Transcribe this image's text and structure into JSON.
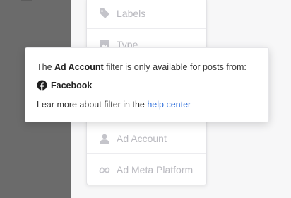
{
  "menu": {
    "items": [
      {
        "label": "Labels",
        "icon": "tag-icon"
      },
      {
        "label": "Type",
        "icon": "image-icon"
      },
      {
        "label": "Ad Account",
        "icon": "person-icon"
      },
      {
        "label": "Ad Meta Platform",
        "icon": "meta-icon"
      }
    ]
  },
  "tooltip": {
    "prefix": "The ",
    "bold_term": "Ad Account",
    "suffix": " filter is only available for posts from:",
    "platform": {
      "label": "Facebook",
      "icon": "facebook-icon"
    },
    "learn_text": "Lear more about filter in the ",
    "link_text": "help center"
  },
  "colors": {
    "left_panel": "#6b6b6b",
    "link": "#2f6fdb",
    "disabled_text": "#b9b9bf"
  }
}
